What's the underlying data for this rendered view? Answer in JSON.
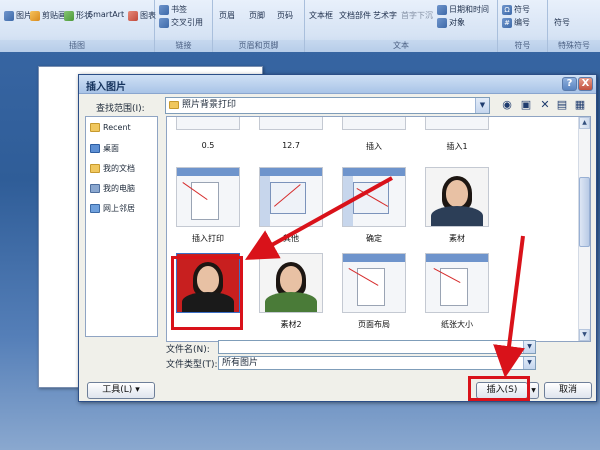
{
  "ribbon": {
    "groups": [
      {
        "title": "插图",
        "items": [
          "图片",
          "剪贴画",
          "形状",
          "SmartArt",
          "图表"
        ]
      },
      {
        "title": "链接",
        "items": [
          "书签",
          "交叉引用"
        ]
      },
      {
        "title": "页眉和页脚",
        "items": [
          "页眉",
          "页脚",
          "页码"
        ]
      },
      {
        "title": "文本",
        "items": [
          "文本框",
          "文档部件",
          "艺术字",
          "首字下沉",
          "日期和时间",
          "对象"
        ]
      },
      {
        "title": "符号",
        "items": [
          "符号",
          "编号"
        ]
      },
      {
        "title": "特殊符号",
        "items": [
          "符号"
        ]
      }
    ]
  },
  "dialog": {
    "title": "插入图片",
    "help_glyph": "?",
    "close_glyph": "X",
    "lookin_label": "查找范围(I):",
    "lookin_value": "照片背景打印",
    "places": [
      "Recent",
      "桌面",
      "我的文档",
      "我的电脑",
      "网上邻居"
    ],
    "top_row_captions": [
      "0.5",
      "12.7",
      "插入",
      "插入1"
    ],
    "files_row1": [
      "插入打印",
      "其他",
      "确定",
      "素材"
    ],
    "files_row2": [
      "",
      "素材2",
      "页面布局",
      "纸张大小"
    ],
    "filename_label": "文件名(N):",
    "filename_value": "",
    "filetype_label": "文件类型(T):",
    "filetype_value": "所有图片",
    "tools_button": "工具(L)",
    "insert_button": "插入(S)",
    "cancel_button": "取消"
  },
  "colors": {
    "annotation_red": "#d9121a",
    "photo_bg_red": "#c81f1f"
  }
}
